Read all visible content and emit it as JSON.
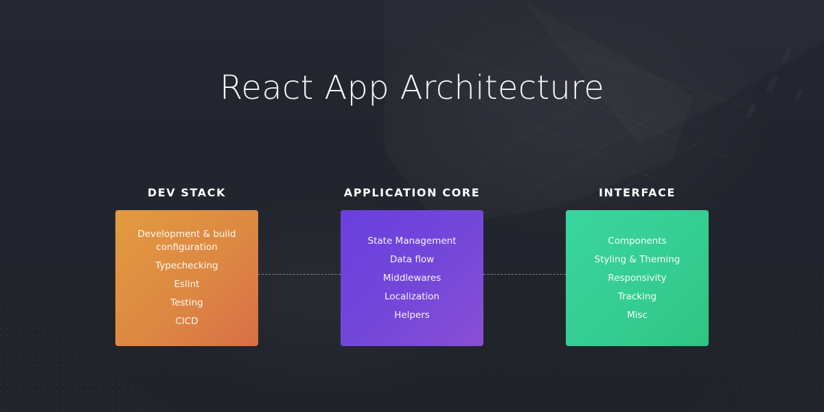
{
  "title": "React App Architecture",
  "columns": [
    {
      "heading": "DEV STACK",
      "color": "#e0903f",
      "items": [
        "Development & build configuration",
        "Typechecking",
        "Eslint",
        "Testing",
        "CICD"
      ]
    },
    {
      "heading": "APPLICATION CORE",
      "color": "#7145dc",
      "items": [
        "State Management",
        "Data flow",
        "Middlewares",
        "Localization",
        "Helpers"
      ]
    },
    {
      "heading": "INTERFACE",
      "color": "#36cf94",
      "items": [
        "Components",
        "Styling & Theming",
        "Responsivity",
        "Tracking",
        "Misc"
      ]
    }
  ]
}
